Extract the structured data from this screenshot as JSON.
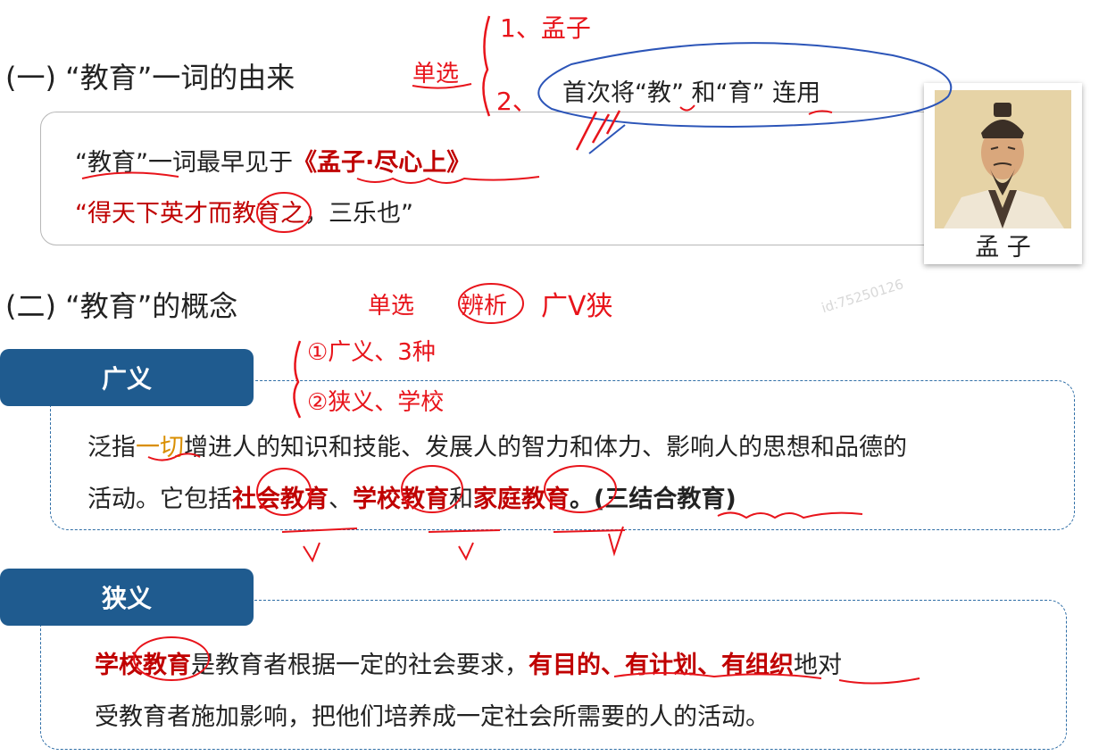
{
  "section1": {
    "heading": "(一) “教育”一词的由来",
    "tag_note": "单选",
    "line1_prefix": "“教育”一词最早见于",
    "line1_book": "《孟子·尽心上》",
    "line2_quote": "“得天下英才而教育之",
    "line2_rest": "，三乐也”",
    "callout": "首次将“教” 和“育” 连用",
    "portrait_caption": "孟 子",
    "margin_note_1": "1、孟子",
    "margin_note_2": "2、"
  },
  "section2": {
    "heading": "(二) “教育”的概念",
    "note_single": "单选",
    "note_analysis": "辨析",
    "note_kinds": "广V狭",
    "margin_note_1": "①广义、3种",
    "margin_note_2": "②狭义、学校",
    "watermark": "id:75250126",
    "broad": {
      "tag": "广义",
      "l1_a": "泛指",
      "l1_b": "一切",
      "l1_c": "增进人的知识和技能、发展人的智力和体力、影响人的思想和品德的",
      "l2_a": "活动。它包括",
      "l2_b": "社会教育",
      "l2_c": "、",
      "l2_d": "学校教育",
      "l2_e": "和",
      "l2_f": "家庭教育",
      "l2_g": "。(三结合教育)"
    },
    "narrow": {
      "tag": "狭义",
      "l1_a": "学校教育",
      "l1_b": "是教育者根据一定的社会要求，",
      "l1_c": "有目的、有计划、有组织",
      "l1_d": "地对",
      "l2": "受教育者施加影响，把他们培养成一定社会所需要的人的活动。"
    }
  },
  "colors": {
    "accent_red": "#c00000",
    "tag_blue": "#1f5b8f",
    "dash_blue": "#2f6ea6",
    "highlight_gold": "#d98e00",
    "ink_red": "#e8141b",
    "callout_blue": "#2c55b8"
  }
}
